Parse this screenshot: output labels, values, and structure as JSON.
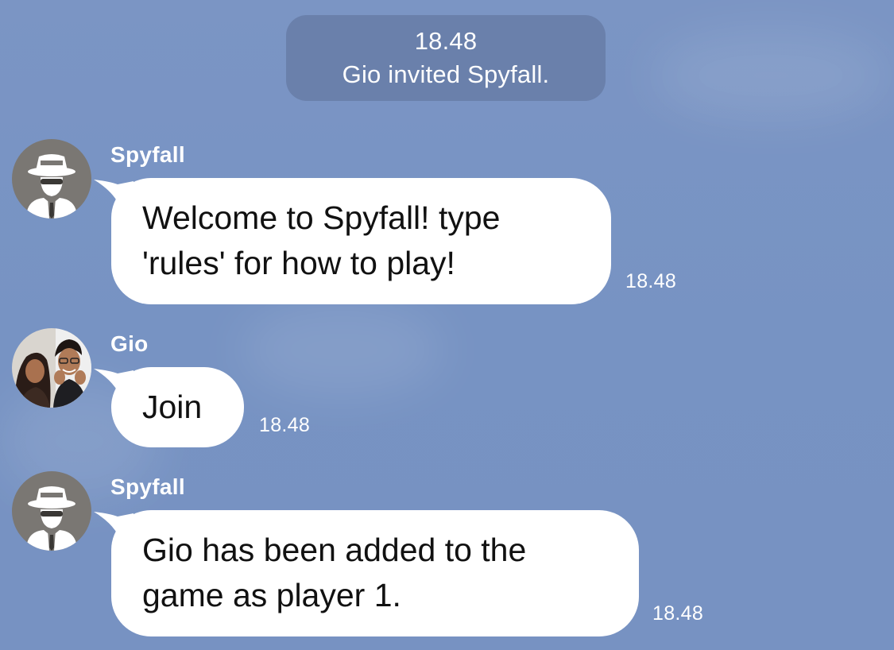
{
  "system_notice": {
    "time": "18.48",
    "text": "Gio invited Spyfall."
  },
  "messages": [
    {
      "sender": "Spyfall",
      "avatar_icon": "spy-avatar-icon",
      "lines": [
        "Welcome to Spyfall! type",
        "'rules' for how to play!"
      ],
      "time": "18.48"
    },
    {
      "sender": "Gio",
      "avatar_icon": "user-photo-avatar",
      "lines": [
        "Join"
      ],
      "time": "18.48"
    },
    {
      "sender": "Spyfall",
      "avatar_icon": "spy-avatar-icon",
      "lines": [
        "Gio has been added to the",
        "game as player 1."
      ],
      "time": "18.48"
    }
  ],
  "colors": {
    "background": "#7b95c4",
    "bubble": "#ffffff",
    "system_pill": "#5c7098",
    "spy_avatar_bg": "#7a7773"
  }
}
